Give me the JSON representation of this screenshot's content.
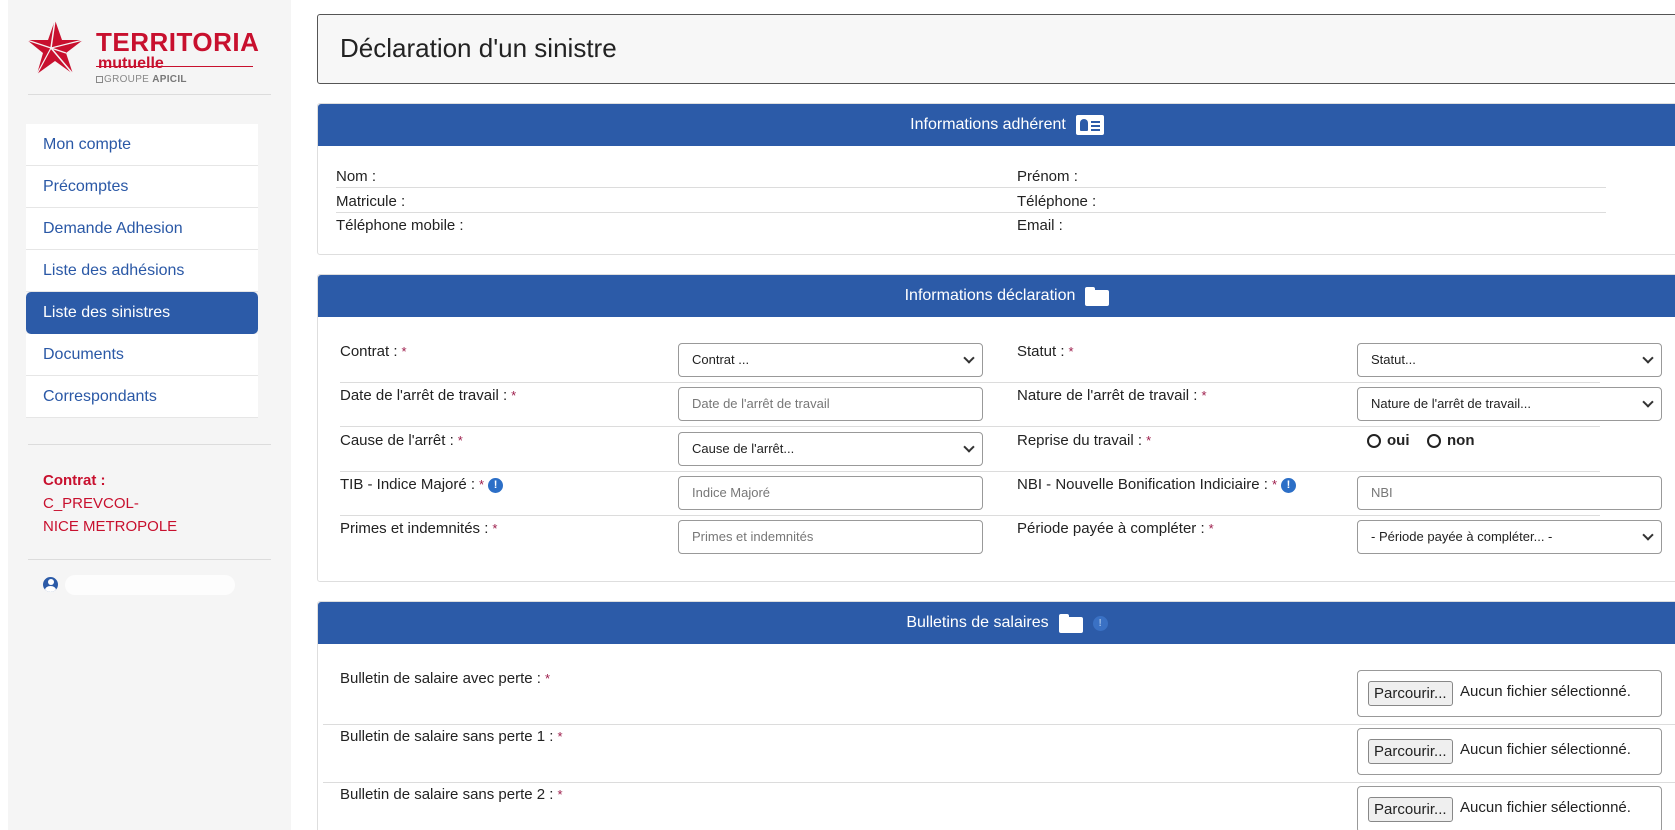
{
  "logo": {
    "brand": "TERRITORIA",
    "sub": "mutuelle",
    "group_prefix": "GROUPE",
    "group_name": "APICIL"
  },
  "sidebar": {
    "items": [
      {
        "label": "Mon compte"
      },
      {
        "label": "Précomptes"
      },
      {
        "label": "Demande Adhesion"
      },
      {
        "label": "Liste des adhésions"
      },
      {
        "label": "Liste des sinistres"
      },
      {
        "label": "Documents"
      },
      {
        "label": "Correspondants"
      }
    ],
    "active_index": 4,
    "contract_label": "Contrat :",
    "contract_code": "C_PREVCOL-",
    "contract_name": "NICE METROPOLE"
  },
  "colors": {
    "primary": "#2c5ba8",
    "brand_red": "#c8102e",
    "required": "#9c1c4a"
  },
  "page": {
    "title": "Déclaration d'un sinistre"
  },
  "adherent": {
    "header": "Informations adhérent",
    "fields": {
      "nom": "Nom :",
      "prenom": "Prénom :",
      "matricule": "Matricule :",
      "telephone": "Téléphone :",
      "mobile": "Téléphone mobile :",
      "email": "Email :"
    }
  },
  "declaration": {
    "header": "Informations déclaration",
    "required_mark": "*",
    "contrat": {
      "label": "Contrat :",
      "value": "Contrat ..."
    },
    "statut": {
      "label": "Statut :",
      "value": "Statut..."
    },
    "date_arret": {
      "label": "Date de l'arrêt de travail :",
      "placeholder": "Date de l'arrêt de travail"
    },
    "nature_arret": {
      "label": "Nature de l'arrêt de travail :",
      "value": "Nature de l'arrêt de travail..."
    },
    "cause_arret": {
      "label": "Cause de l'arrêt :",
      "value": "Cause de l'arrêt..."
    },
    "reprise": {
      "label": "Reprise du travail :",
      "oui": "oui",
      "non": "non"
    },
    "tib": {
      "label": "TIB - Indice Majoré :",
      "placeholder": "Indice Majoré"
    },
    "nbi": {
      "label": "NBI - Nouvelle Bonification Indiciaire :",
      "placeholder": "NBI"
    },
    "primes": {
      "label": "Primes et indemnités :",
      "placeholder": "Primes et indemnités"
    },
    "periode": {
      "label": "Période payée à compléter :",
      "value": "- Période payée à compléter... -"
    }
  },
  "bulletins": {
    "header": "Bulletins de salaires",
    "browse_label": "Parcourir...",
    "no_file": "Aucun fichier sélectionné.",
    "items": [
      {
        "label": "Bulletin de salaire avec perte :"
      },
      {
        "label": "Bulletin de salaire sans perte 1 :"
      },
      {
        "label": "Bulletin de salaire sans perte 2 :"
      }
    ]
  },
  "icons": {
    "card": "id-card-icon",
    "folder": "folder-icon",
    "info": "info-icon",
    "user": "user-circle-icon"
  }
}
